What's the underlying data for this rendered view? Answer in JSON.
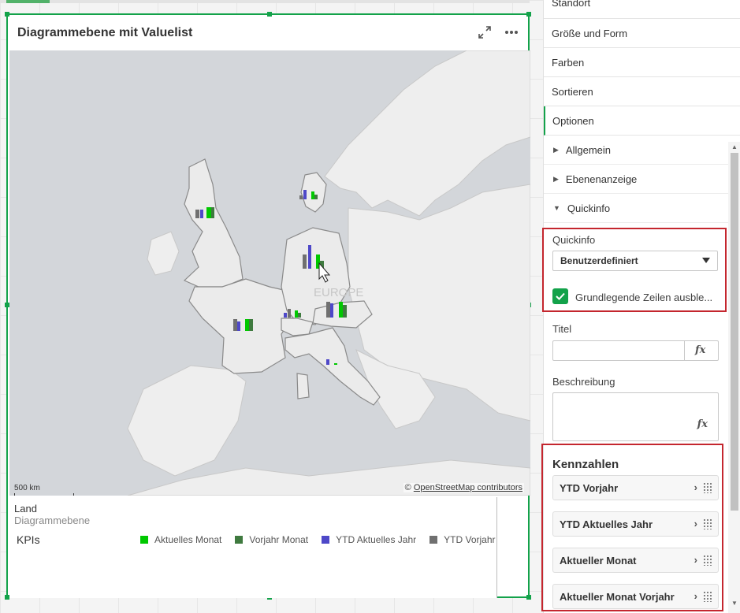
{
  "viz": {
    "title": "Diagrammebene mit Valuelist",
    "expand_icon": "expand-icon",
    "more_icon": "more-icon",
    "map": {
      "region_label": "EUROPE",
      "scale_label": "500 km",
      "attribution_prefix": "©",
      "attribution_link": "OpenStreetMap contributors"
    },
    "legend": {
      "land_label": "Land",
      "layer_label": "Diagrammebene",
      "kpis_label": "KPIs",
      "items": [
        {
          "label": "Aktuelles Monat",
          "color": "#00c800"
        },
        {
          "label": "Vorjahr Monat",
          "color": "#3f7a3f"
        },
        {
          "label": "YTD Aktuelles Jahr",
          "color": "#4e48c8"
        },
        {
          "label": "YTD Vorjahr",
          "color": "#707070"
        }
      ]
    }
  },
  "panel": {
    "nav": [
      "Standort",
      "Größe und Form",
      "Farben",
      "Sortieren",
      "Optionen"
    ],
    "sub_sections": [
      "Allgemein",
      "Ebenenanzeige",
      "Quickinfo"
    ],
    "quickinfo": {
      "label": "Quickinfo",
      "select_value": "Benutzerdefiniert",
      "checkbox_label": "Grundlegende Zeilen ausble...",
      "checkbox_checked": true
    },
    "titel_label": "Titel",
    "titel_value": "",
    "beschreibung_label": "Beschreibung",
    "beschreibung_value": "",
    "fx_label": "fx",
    "kennzahlen": {
      "header": "Kennzahlen",
      "items": [
        "YTD Vorjahr",
        "YTD Aktuelles Jahr",
        "Aktueller Monat",
        "Aktueller Monat Vorjahr"
      ]
    }
  }
}
